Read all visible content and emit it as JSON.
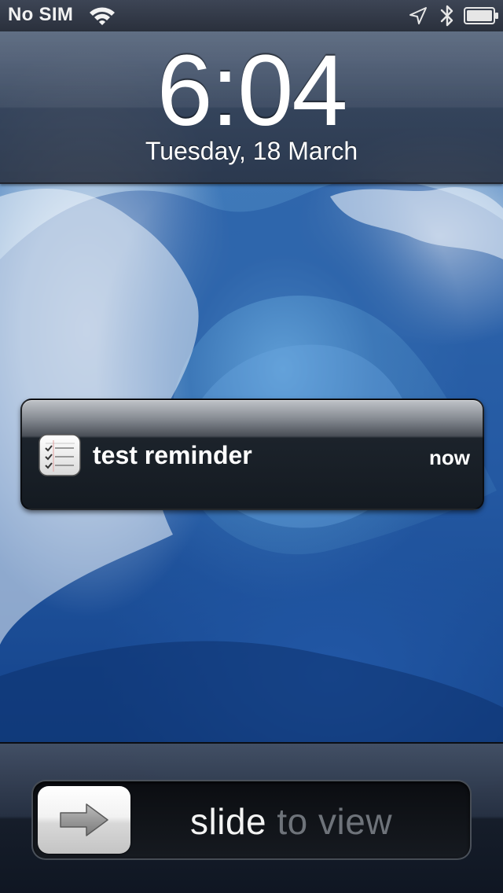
{
  "status_bar": {
    "carrier": "No SIM",
    "icons": [
      "wifi-icon",
      "location-icon",
      "bluetooth-icon",
      "battery-icon"
    ]
  },
  "lock_clock": {
    "time": "6:04",
    "date": "Tuesday, 18 March"
  },
  "notification": {
    "app_icon": "reminders-icon",
    "title": "test reminder",
    "time": "now"
  },
  "unlock_slider": {
    "label_highlight": "slide",
    "label_rest": " to view",
    "knob_icon": "arrow-icon"
  },
  "colors": {
    "bar_dark": "#2a303c",
    "text_white": "#ffffff",
    "slider_dim_text": "#6e737a"
  }
}
